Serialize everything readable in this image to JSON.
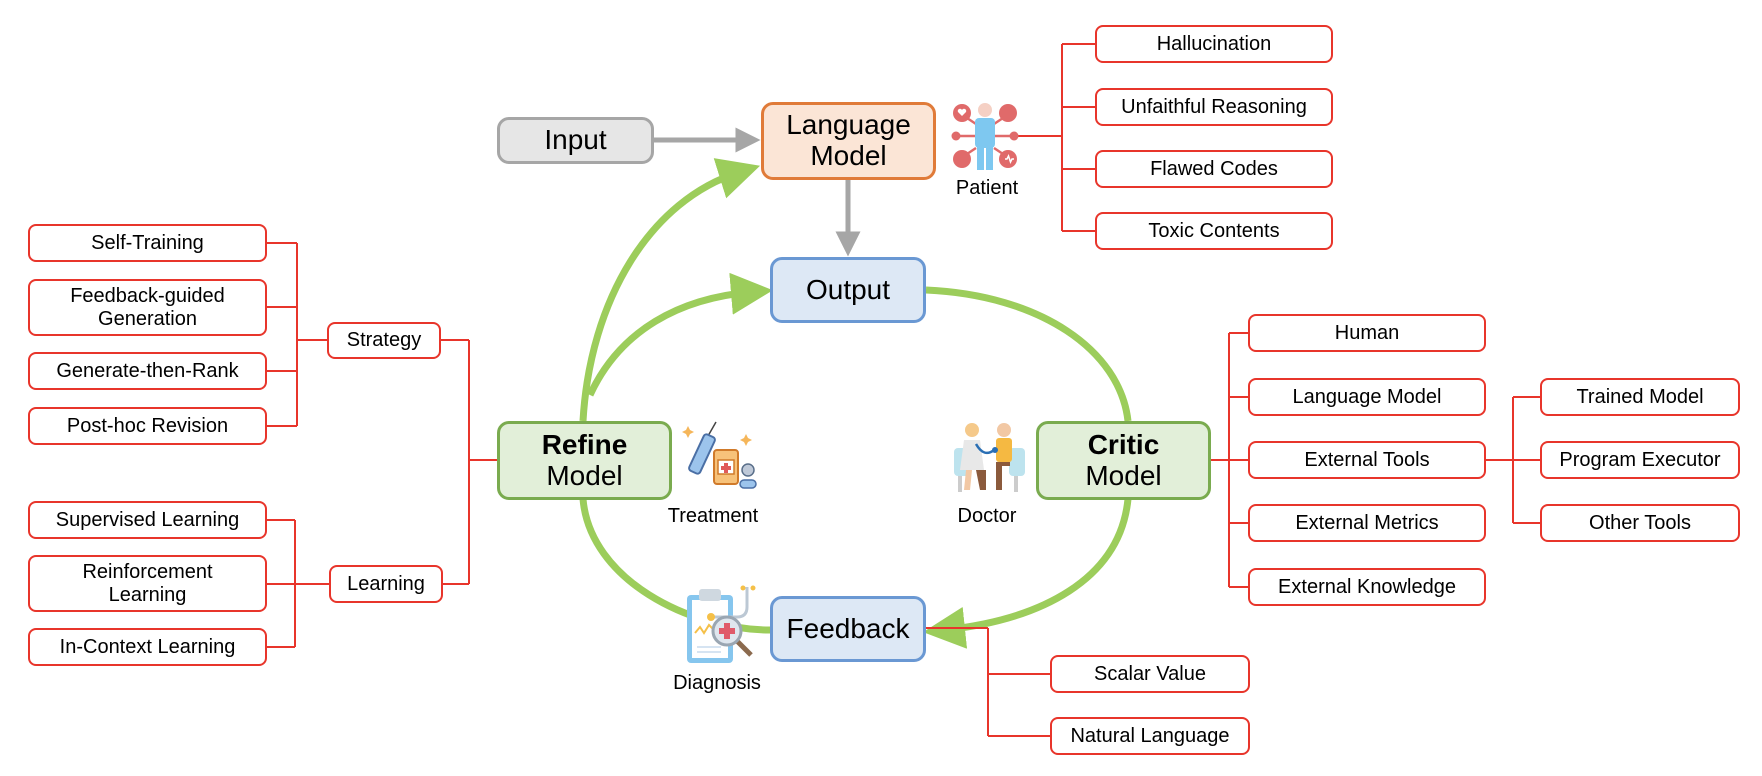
{
  "colors": {
    "tree_line": "#e8352b",
    "loop_arrow": "#9ccd5b",
    "flow_arrow": "#a6a6a6",
    "input_fill": "#e6e6e6",
    "lm_fill": "#fbe5d6",
    "lm_border": "#e07b39",
    "io_fill": "#dde8f5",
    "io_border": "#6a98d3",
    "model_fill": "#e2efd9",
    "model_border": "#7aab4f"
  },
  "core": {
    "input": "Input",
    "language_model": [
      "Language",
      "Model"
    ],
    "output": "Output",
    "feedback": "Feedback",
    "refine_model": {
      "bold": "Refine",
      "rest": "Model"
    },
    "critic_model": {
      "bold": "Critic",
      "rest": "Model"
    }
  },
  "metaphors": {
    "patient": {
      "label": "Patient",
      "icon": "patient-icon"
    },
    "treatment": {
      "label": "Treatment",
      "icon": "treatment-icon"
    },
    "doctor": {
      "label": "Doctor",
      "icon": "doctor-icon"
    },
    "diagnosis": {
      "label": "Diagnosis",
      "icon": "diagnosis-icon"
    }
  },
  "problems": [
    "Hallucination",
    "Unfaithful Reasoning",
    "Flawed Codes",
    "Toxic Contents"
  ],
  "refine": {
    "strategy": {
      "label": "Strategy",
      "children": [
        "Self-Training",
        [
          "Feedback-guided",
          "Generation"
        ],
        "Generate-then-Rank",
        "Post-hoc Revision"
      ]
    },
    "learning": {
      "label": "Learning",
      "children": [
        "Supervised Learning",
        [
          "Reinforcement",
          "Learning"
        ],
        "In-Context Learning"
      ]
    }
  },
  "critic": {
    "children": [
      "Human",
      "Language Model",
      "External Tools",
      "External Metrics",
      "External Knowledge"
    ],
    "external_tools": [
      "Trained Model",
      "Program Executor",
      "Other Tools"
    ]
  },
  "feedback_types": [
    "Scalar Value",
    "Natural Language"
  ]
}
